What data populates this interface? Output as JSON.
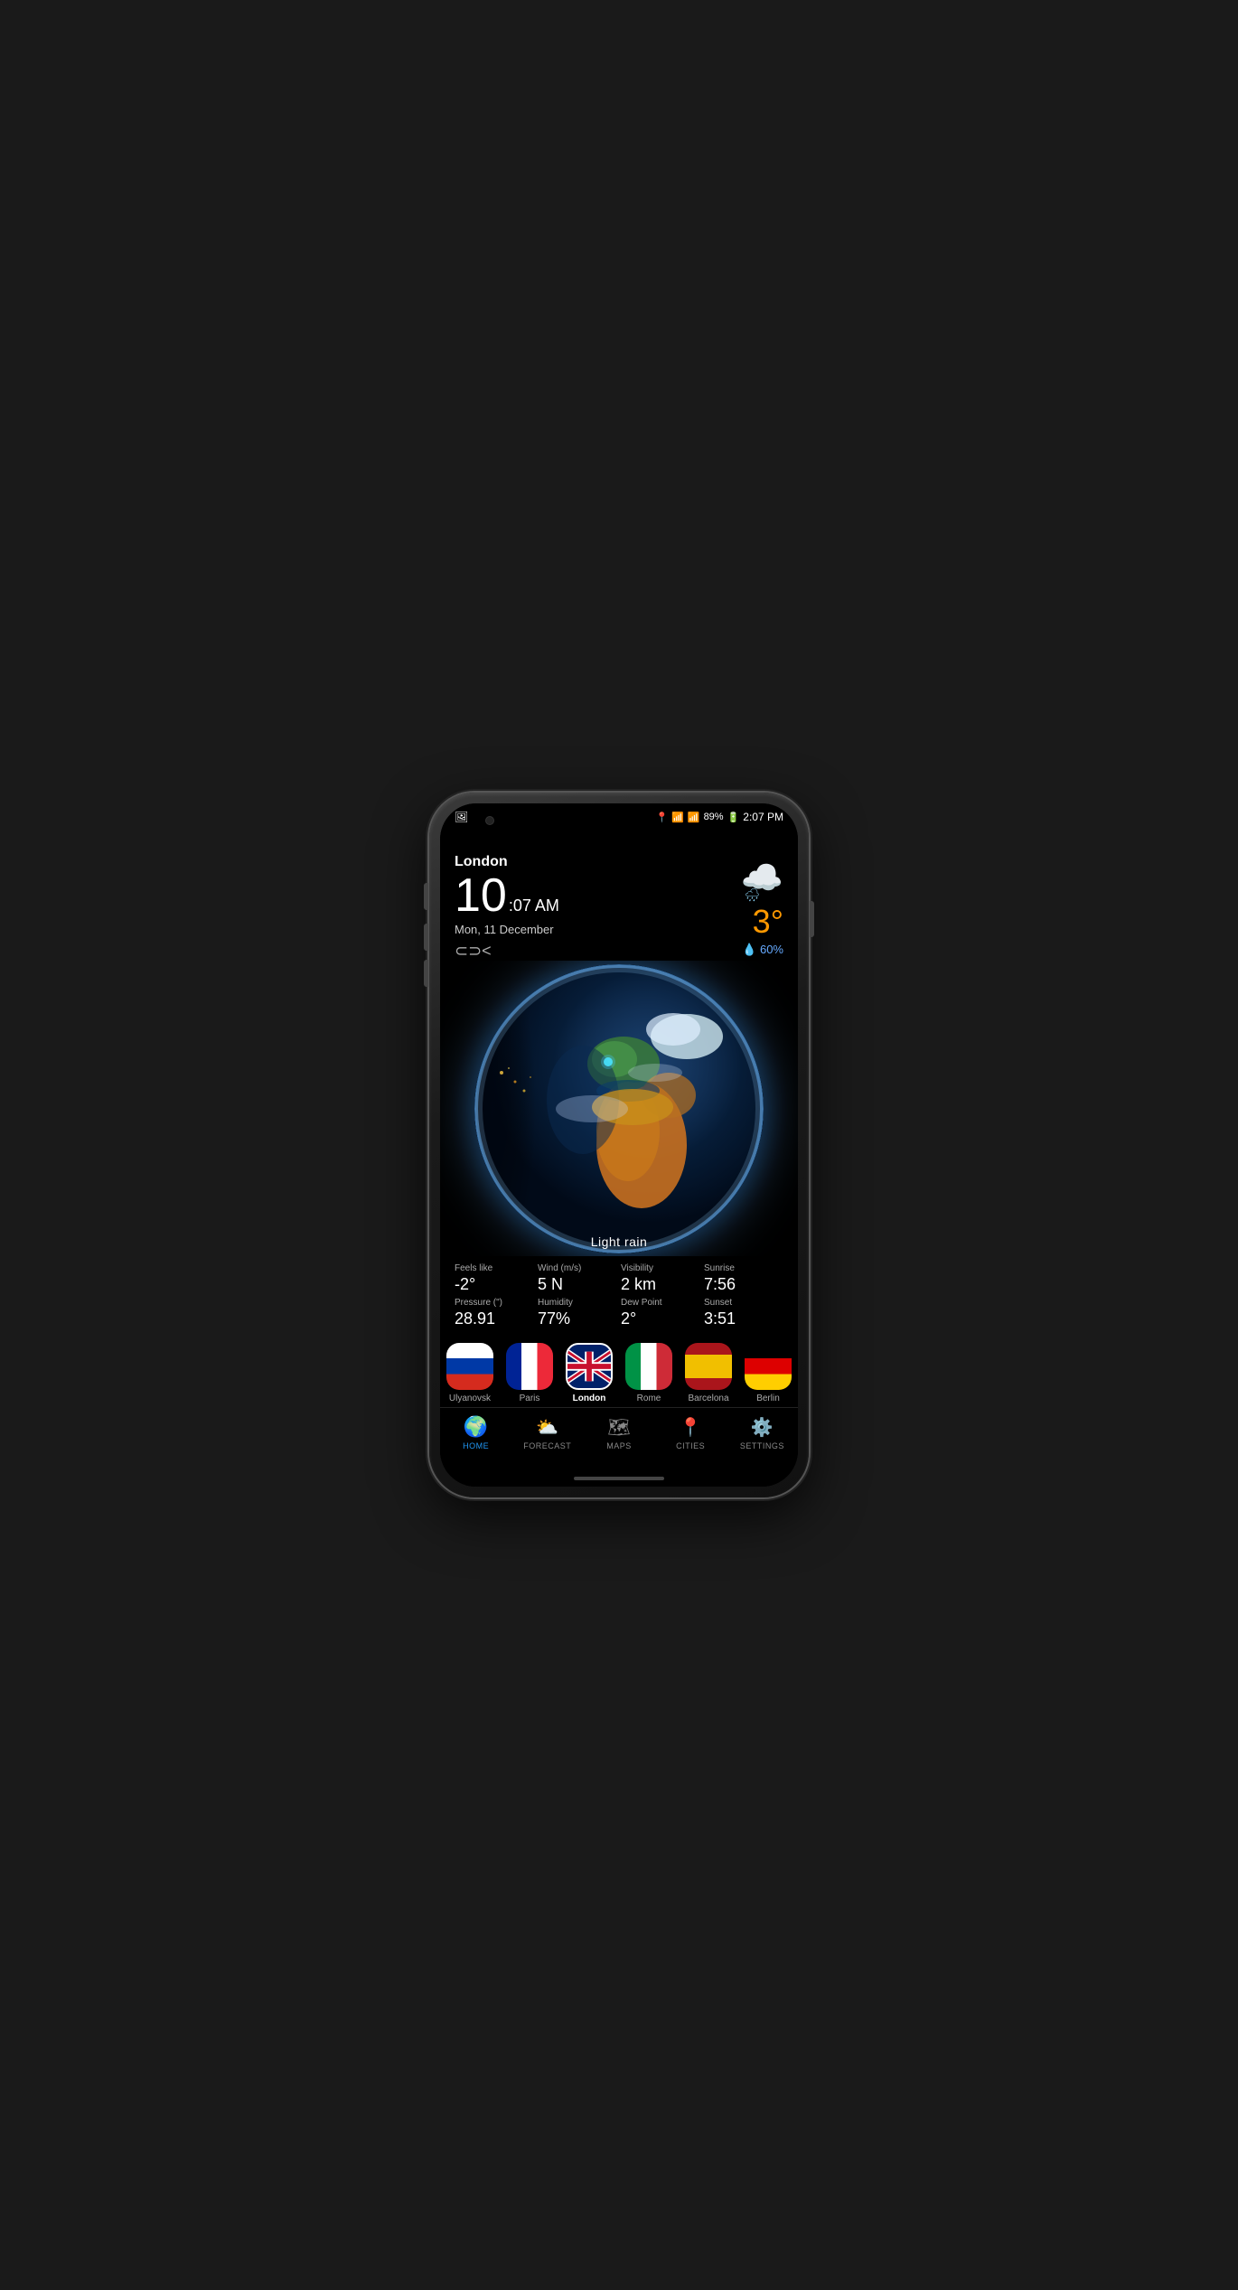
{
  "phone": {
    "status_bar": {
      "location_icon": "📍",
      "wifi_icon": "wifi",
      "signal_icon": "signal",
      "battery": "89%",
      "time": "2:07 PM"
    },
    "weather_app": {
      "city": "London",
      "time_hour": "10",
      "time_minute_ampm": ":07 AM",
      "date": "Mon, 11 December",
      "temperature": "3°",
      "precipitation_chance": "💧 60%",
      "weather_condition": "Light rain",
      "share_icon": "share",
      "stats": [
        {
          "label": "Feels like",
          "value": "-2°"
        },
        {
          "label": "Wind (m/s)",
          "value": "5 N"
        },
        {
          "label": "Visibility",
          "value": "2 km"
        },
        {
          "label": "Sunrise",
          "value": "7:56"
        },
        {
          "label": "Pressure (\")",
          "value": "28.91"
        },
        {
          "label": "Humidity",
          "value": "77%"
        },
        {
          "label": "Dew Point",
          "value": "2°"
        },
        {
          "label": "Sunset",
          "value": "3:51"
        }
      ],
      "cities": [
        {
          "name": "Ulyanovsk",
          "flag": "russia",
          "selected": false,
          "starred": true
        },
        {
          "name": "Paris",
          "flag": "france",
          "selected": false,
          "starred": false
        },
        {
          "name": "London",
          "flag": "uk",
          "selected": true,
          "starred": false
        },
        {
          "name": "Rome",
          "flag": "italy",
          "selected": false,
          "starred": false
        },
        {
          "name": "Barcelona",
          "flag": "spain",
          "selected": false,
          "starred": false
        },
        {
          "name": "Berlin",
          "flag": "germany",
          "selected": false,
          "starred": false
        }
      ],
      "nav": [
        {
          "id": "home",
          "label": "HOME",
          "active": true
        },
        {
          "id": "forecast",
          "label": "FORECAST",
          "active": false
        },
        {
          "id": "maps",
          "label": "MAPS",
          "active": false
        },
        {
          "id": "cities",
          "label": "CITIES",
          "active": false
        },
        {
          "id": "settings",
          "label": "SETTINGS",
          "active": false
        }
      ]
    }
  }
}
